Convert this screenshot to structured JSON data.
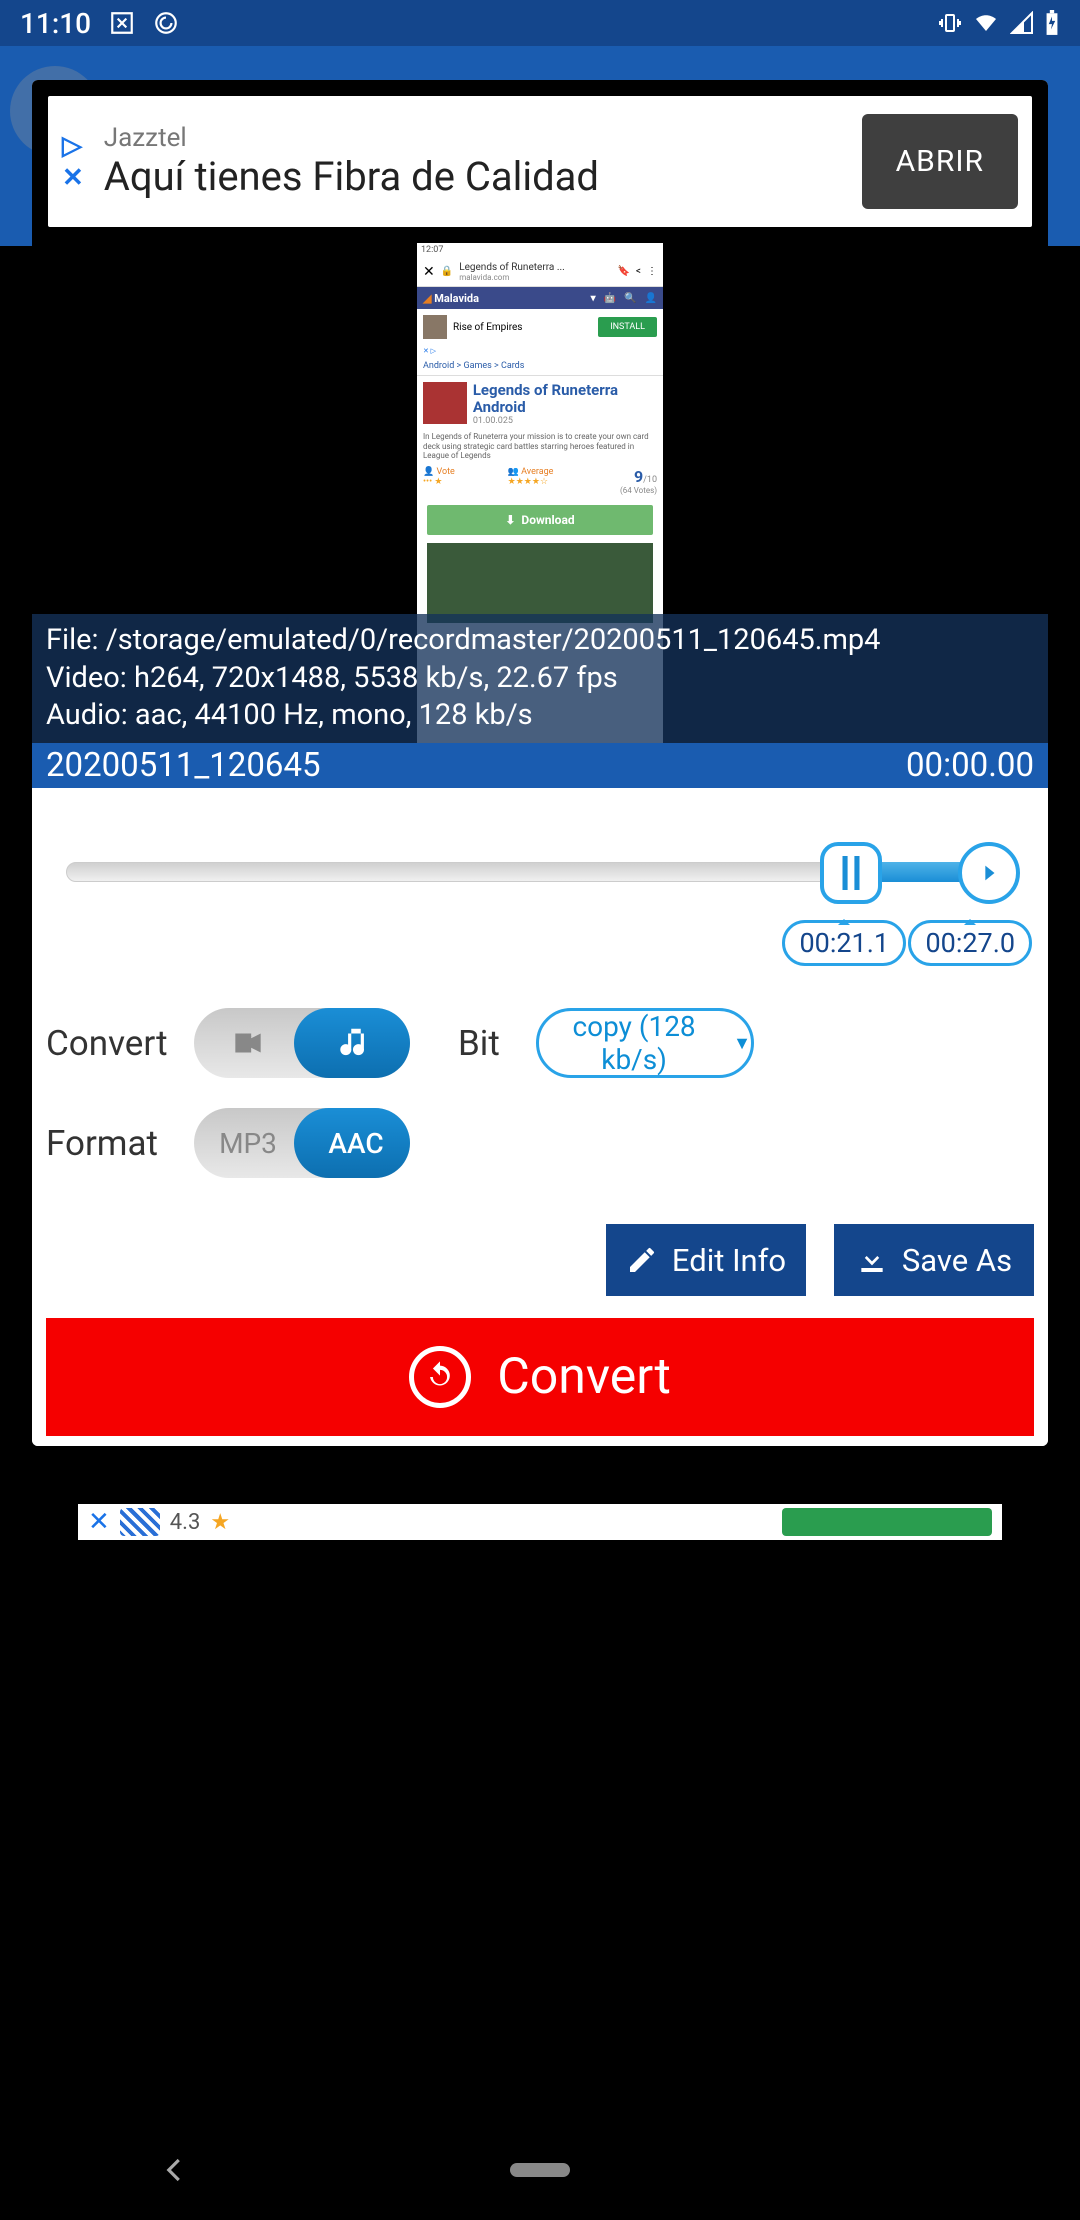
{
  "statusbar": {
    "time": "11:10"
  },
  "ad": {
    "brand": "Jazztel",
    "headline": "Aquí tienes Fibra de Calidad",
    "cta": "ABRIR"
  },
  "preview_shot": {
    "time": "12:07",
    "url_title": "Legends of Runeterra ...",
    "url_sub": "malavida.com",
    "nav_brand": "Malavida",
    "promo_name": "Rise of Empires",
    "promo_btn": "INSTALL",
    "breadcrumb": "Android > Games > Cards",
    "game_title": "Legends of Runeterra Android",
    "game_version": "01.00.025",
    "game_desc": "In Legends of Runeterra your mission is to create your own card deck using strategic card battles starring heroes featured in League of Legends",
    "vote": "Vote",
    "avg": "Average",
    "score": "9",
    "score_of": "/10",
    "votes": "(64 Votes)",
    "download": "Download"
  },
  "file_info": {
    "line1": "File: /storage/emulated/0/recordmaster/20200511_120645.mp4",
    "line2": "Video: h264, 720x1488,  5538 kb/s,  22.67 fps",
    "line3": "Audio: aac,  44100 Hz,  mono, 128 kb/s"
  },
  "title": {
    "name": "20200511_120645",
    "duration": "00:00.00"
  },
  "trim": {
    "start": "00:21.1",
    "end": "00:27.0"
  },
  "labels": {
    "convert": "Convert",
    "format": "Format",
    "bit": "Bit"
  },
  "toggle_format": {
    "left": "MP3",
    "right": "AAC"
  },
  "bit_btn": "copy (128 kb/s)",
  "actions": {
    "edit": "Edit Info",
    "save": "Save As"
  },
  "convert_btn": "Convert",
  "bottom": {
    "rating": "4.3"
  }
}
